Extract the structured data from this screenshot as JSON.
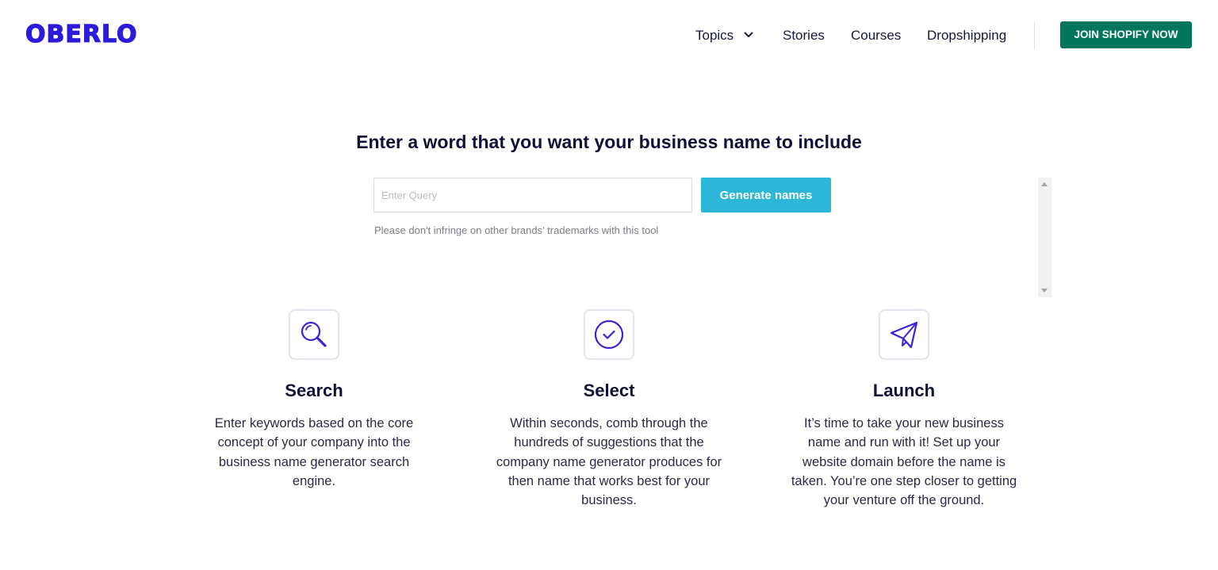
{
  "header": {
    "logo": "OBERLO",
    "nav": [
      {
        "label": "Topics",
        "has_dropdown": true
      },
      {
        "label": "Stories"
      },
      {
        "label": "Courses"
      },
      {
        "label": "Dropshipping"
      }
    ],
    "cta_label": "JOIN SHOPIFY NOW"
  },
  "main": {
    "headline": "Enter a word that you want your business name to include",
    "search": {
      "placeholder": "Enter Query",
      "value": "",
      "button_label": "Generate names",
      "disclaimer": "Please don't infringe on other brands' trademarks with this tool"
    }
  },
  "features": [
    {
      "icon": "search-icon",
      "title": "Search",
      "desc_lines": [
        "Enter keywords based on the core",
        "concept of your company into the",
        "business name generator search",
        "engine."
      ]
    },
    {
      "icon": "check-circle-icon",
      "title": "Select",
      "desc_lines": [
        "Within seconds, comb through the",
        "hundreds of suggestions that the",
        "company name generator produces for",
        "then name that works best for your",
        "business."
      ]
    },
    {
      "icon": "paper-plane-icon",
      "title": "Launch",
      "desc_lines": [
        "It’s time to take your new business",
        "name and run with it! Set up your",
        "website domain before the name is",
        "taken. You’re one step closer to getting",
        "your venture off the ground."
      ]
    }
  ],
  "colors": {
    "brand": "#2b1bdb",
    "cta": "#00775a",
    "button": "#2cb6d8",
    "icon_stroke": "#3a24d6"
  }
}
